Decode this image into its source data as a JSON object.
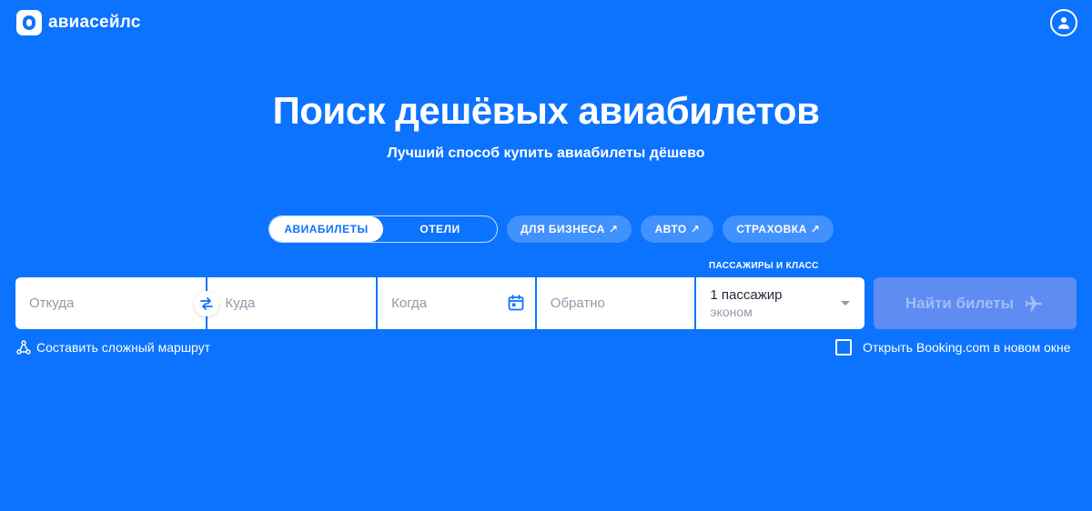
{
  "header": {
    "brand": "авиасейлс"
  },
  "hero": {
    "title": "Поиск дешёвых авиабилетов",
    "subtitle": "Лучший способ купить авиабилеты дёшево"
  },
  "tabs": [
    {
      "label": "АВИАБИЛЕТЫ",
      "active": true
    },
    {
      "label": "ОТЕЛИ",
      "active": false
    }
  ],
  "external_links": [
    {
      "label": "ДЛЯ БИЗНЕСА",
      "arrow": "↗"
    },
    {
      "label": "АВТО",
      "arrow": "↗"
    },
    {
      "label": "СТРАХОВКА",
      "arrow": "↗"
    }
  ],
  "search": {
    "from_placeholder": "Откуда",
    "to_placeholder": "Куда",
    "when_placeholder": "Когда",
    "back_placeholder": "Обратно",
    "passengers_caption": "ПАССАЖИРЫ И КЛАСС",
    "passengers_value": "1 пассажир",
    "class_value": "эконом",
    "submit_label": "Найти билеты"
  },
  "options": {
    "complex_route": "Составить сложный маршрут",
    "open_booking": "Открыть Booking.com в новом окне",
    "open_booking_checked": false
  },
  "colors": {
    "background": "#0c73fe",
    "button_disabled": "#5e8cf0"
  }
}
